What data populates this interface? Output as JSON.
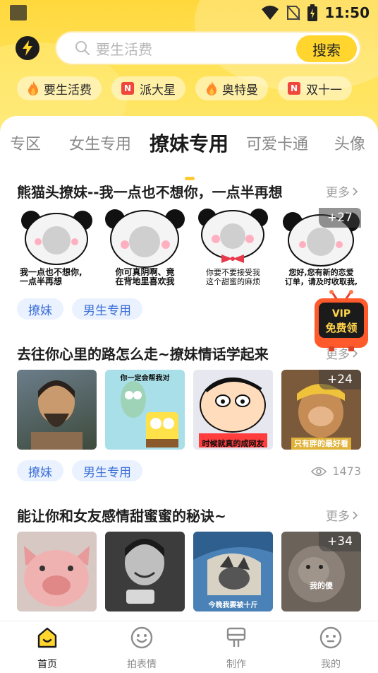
{
  "status_bar": {
    "time": "11:50"
  },
  "search": {
    "placeholder": "要生活费",
    "button_label": "搜索"
  },
  "hot_tags": [
    {
      "label": "要生活费",
      "icon": "flame-icon"
    },
    {
      "label": "派大星",
      "icon": "n-badge-icon",
      "badge": "N"
    },
    {
      "label": "奥特曼",
      "icon": "flame-icon"
    },
    {
      "label": "双十一",
      "icon": "n-badge-icon",
      "badge": "N"
    }
  ],
  "category_tabs": [
    {
      "label": "专区"
    },
    {
      "label": "女生专用"
    },
    {
      "label": "撩妹专用",
      "active": true
    },
    {
      "label": "可爱卡通"
    },
    {
      "label": "头像"
    }
  ],
  "sections": [
    {
      "title": "熊猫头撩妹--我一点也不想你，一点半再想",
      "more": "更多",
      "thumbs": [
        {
          "caption": "我一点也不想你,\n一点半再想"
        },
        {
          "caption": "你可真阴啊、竟\n在背地里喜欢我"
        },
        {
          "caption": "你要不要接受我\n这个甜蜜的麻烦"
        },
        {
          "caption": "您好,您有新的恋爱\n订单，请及时收取我,",
          "count": "+27"
        }
      ],
      "chips": [
        "撩妹",
        "男生专用"
      ]
    },
    {
      "title": "去往你心里的路怎么走~撩妹情话学起来",
      "more": "更多",
      "thumbs": [
        {
          "caption": ""
        },
        {
          "caption": "你一定会帮我对"
        },
        {
          "caption": "时候就真的成网友"
        },
        {
          "caption": "只有胖的最好看",
          "count": "+24"
        }
      ],
      "chips": [
        "撩妹",
        "男生专用"
      ],
      "views": "1473"
    },
    {
      "title": "能让你和女友感情甜蜜蜜的秘诀~",
      "more": "更多",
      "thumbs": [
        {
          "caption": ""
        },
        {
          "caption": ""
        },
        {
          "caption": "今晚我要被十斤"
        },
        {
          "caption": "我的傻",
          "count": "+34"
        }
      ]
    }
  ],
  "vip_badge": {
    "line1": "VIP",
    "line2": "免费领"
  },
  "bottom_nav": [
    {
      "label": "首页",
      "icon": "home-icon",
      "active": true
    },
    {
      "label": "拍表情",
      "icon": "smile-face-icon"
    },
    {
      "label": "制作",
      "icon": "stamp-icon"
    },
    {
      "label": "我的",
      "icon": "profile-face-icon"
    }
  ],
  "colors": {
    "brand_yellow": "#ffd52e",
    "chip_blue": "#3b6fd8",
    "badge_red": "#f0463c"
  }
}
